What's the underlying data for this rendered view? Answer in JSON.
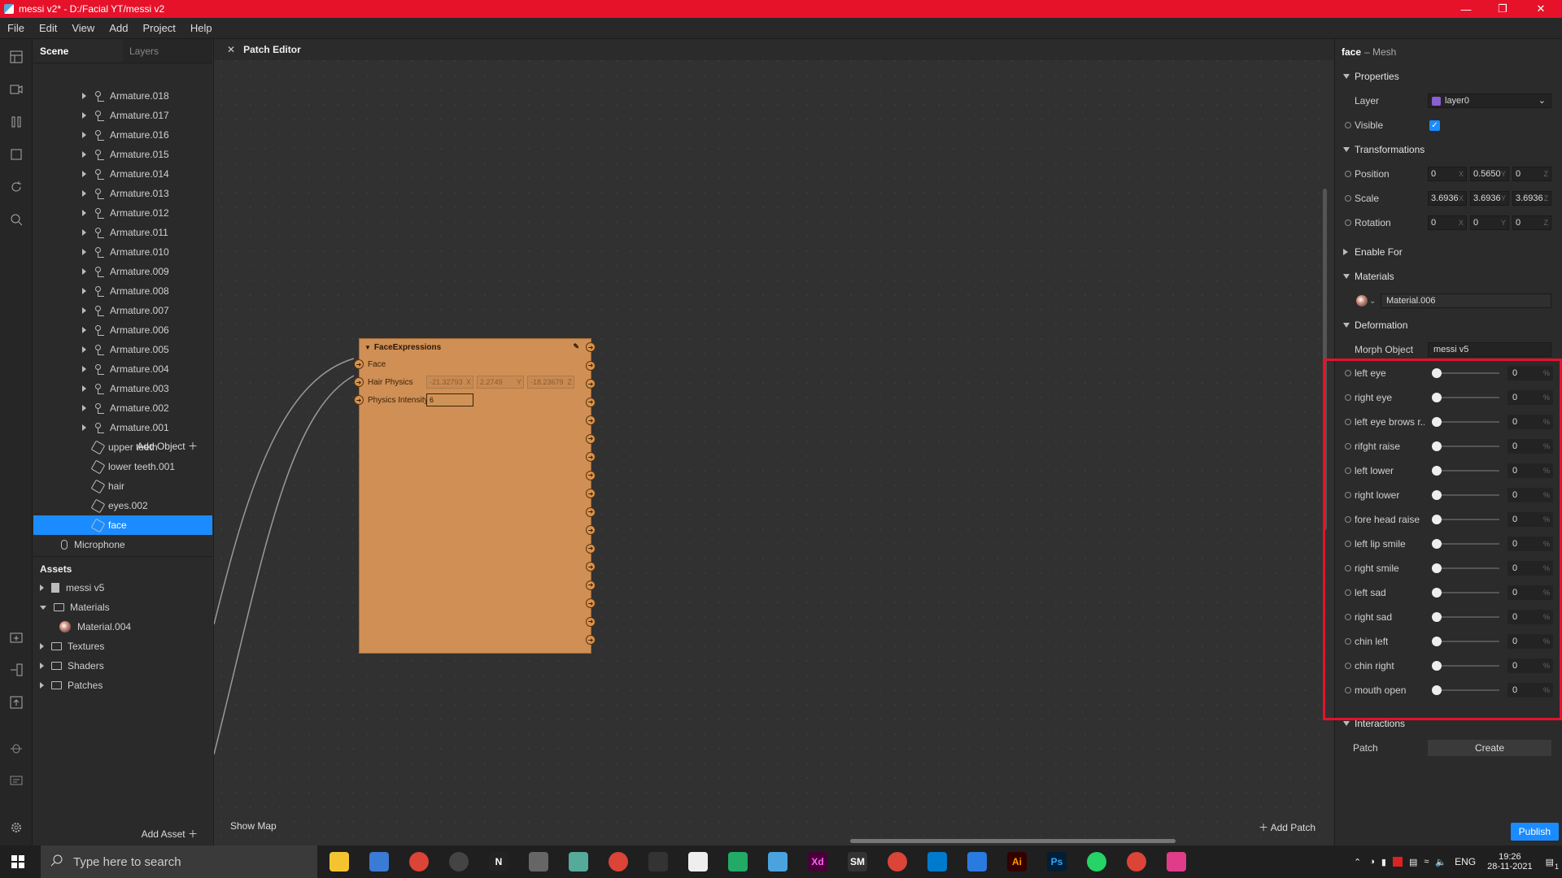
{
  "window": {
    "title": "messi v2* - D:/Facial YT/messi v2"
  },
  "menu": [
    "File",
    "Edit",
    "View",
    "Add",
    "Project",
    "Help"
  ],
  "scene": {
    "tabs": [
      "Scene",
      "Layers"
    ],
    "items": [
      {
        "label": "Armature.018",
        "type": "bone"
      },
      {
        "label": "Armature.017",
        "type": "bone"
      },
      {
        "label": "Armature.016",
        "type": "bone"
      },
      {
        "label": "Armature.015",
        "type": "bone"
      },
      {
        "label": "Armature.014",
        "type": "bone"
      },
      {
        "label": "Armature.013",
        "type": "bone"
      },
      {
        "label": "Armature.012",
        "type": "bone"
      },
      {
        "label": "Armature.011",
        "type": "bone"
      },
      {
        "label": "Armature.010",
        "type": "bone"
      },
      {
        "label": "Armature.009",
        "type": "bone"
      },
      {
        "label": "Armature.008",
        "type": "bone"
      },
      {
        "label": "Armature.007",
        "type": "bone"
      },
      {
        "label": "Armature.006",
        "type": "bone"
      },
      {
        "label": "Armature.005",
        "type": "bone"
      },
      {
        "label": "Armature.004",
        "type": "bone"
      },
      {
        "label": "Armature.003",
        "type": "bone"
      },
      {
        "label": "Armature.002",
        "type": "bone"
      },
      {
        "label": "Armature.001",
        "type": "bone"
      },
      {
        "label": "upper teeth",
        "type": "mesh"
      },
      {
        "label": "lower teeth.001",
        "type": "mesh"
      },
      {
        "label": "hair",
        "type": "mesh"
      },
      {
        "label": "eyes.002",
        "type": "mesh"
      },
      {
        "label": "face",
        "type": "mesh",
        "selected": true
      },
      {
        "label": "Microphone",
        "type": "mic"
      }
    ],
    "add_object": "Add Object"
  },
  "assets": {
    "title": "Assets",
    "items": [
      {
        "label": "messi v5",
        "type": "file"
      },
      {
        "label": "Materials",
        "type": "folder",
        "open": true
      },
      {
        "label": "Material.004",
        "type": "material"
      },
      {
        "label": "Textures",
        "type": "folder"
      },
      {
        "label": "Shaders",
        "type": "folder"
      },
      {
        "label": "Patches",
        "type": "folder"
      }
    ],
    "add_asset": "Add Asset"
  },
  "patch_editor": {
    "title": "Patch Editor",
    "patch": {
      "name": "FaceExpressions",
      "inputs": [
        {
          "label": "Face"
        },
        {
          "label": "Hair Physics",
          "values": [
            "-21.32793",
            "2.2749",
            "-18.23679"
          ],
          "axes": [
            "X",
            "Y",
            "Z"
          ]
        },
        {
          "label": "Physics Intensity",
          "value": "6"
        }
      ],
      "output_count": 17
    },
    "show_map": "Show Map",
    "add_patch": "Add Patch"
  },
  "properties": {
    "object_name": "face",
    "object_type": "– Mesh",
    "sections": {
      "properties": "Properties",
      "transformations": "Transformations",
      "enable_for": "Enable For",
      "materials": "Materials",
      "deformation": "Deformation",
      "interactions": "Interactions"
    },
    "layer_label": "Layer",
    "layer_value": "layer0",
    "layer_color": "#8a5fd1",
    "visible_label": "Visible",
    "position": {
      "label": "Position",
      "values": [
        "0",
        "0.5650",
        "0"
      ]
    },
    "scale": {
      "label": "Scale",
      "values": [
        "3.6936",
        "3.6936",
        "3.6936"
      ]
    },
    "rotation": {
      "label": "Rotation",
      "values": [
        "0",
        "0",
        "0"
      ]
    },
    "axes": [
      "X",
      "Y",
      "Z"
    ],
    "material": "Material.006",
    "morph_object_label": "Morph Object",
    "morph_object_value": "messi v5",
    "blendshapes": [
      {
        "label": "left eye",
        "value": "0"
      },
      {
        "label": "right eye",
        "value": "0"
      },
      {
        "label": "left eye brows r...",
        "value": "0"
      },
      {
        "label": "rifght raise",
        "value": "0"
      },
      {
        "label": "left lower",
        "value": "0"
      },
      {
        "label": "right lower",
        "value": "0"
      },
      {
        "label": "fore head raise",
        "value": "0"
      },
      {
        "label": "left lip smile",
        "value": "0"
      },
      {
        "label": "right smile",
        "value": "0"
      },
      {
        "label": "left sad",
        "value": "0"
      },
      {
        "label": "right sad",
        "value": "0"
      },
      {
        "label": "chin left",
        "value": "0"
      },
      {
        "label": "chin right",
        "value": "0"
      },
      {
        "label": "mouth open",
        "value": "0"
      }
    ],
    "unit": "%",
    "patch_label": "Patch",
    "create_label": "Create",
    "publish": "Publish"
  },
  "taskbar": {
    "search_placeholder": "Type here to search",
    "apps": [
      "file-explorer",
      "store",
      "chrome",
      "obs",
      "notion",
      "app",
      "paint",
      "chrome",
      "defender",
      "notepad",
      "editor",
      "tool",
      "xd",
      "sm",
      "chrome",
      "vscode",
      "app",
      "illustrator",
      "photoshop",
      "whatsapp",
      "chrome",
      "spark-ar"
    ],
    "language": "ENG",
    "time": "19:26",
    "date": "28-11-2021",
    "notifications": "1"
  },
  "colors": {
    "titlebar": "#e5122a",
    "accent": "#1a8cff",
    "patch": "#cf8f55",
    "highlight": "#e5122a"
  }
}
